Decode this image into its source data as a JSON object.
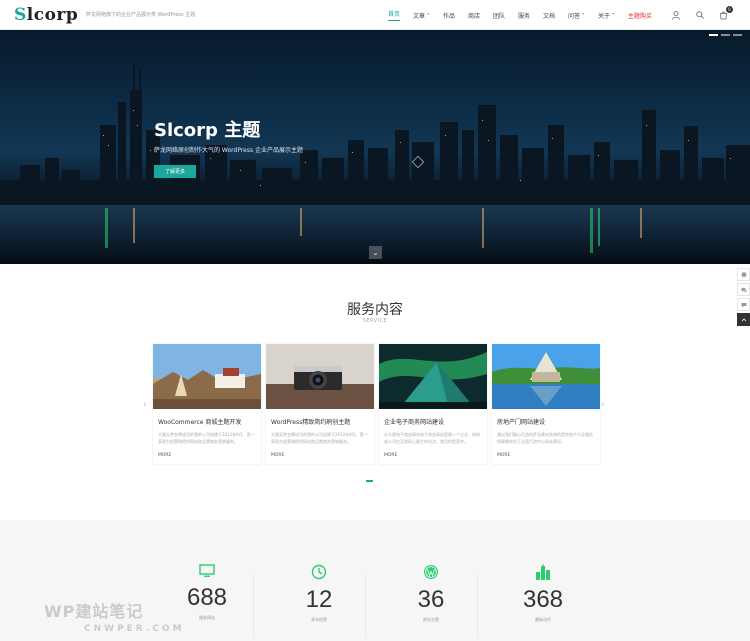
{
  "header": {
    "logo": "lcorp",
    "logo_first": "S",
    "tagline": "萨龙网络旗下的企业产品展示类 WordPress 主题",
    "nav": [
      {
        "label": "首页",
        "active": true
      },
      {
        "label": "文章 ˅"
      },
      {
        "label": "作品"
      },
      {
        "label": "商店"
      },
      {
        "label": "团队"
      },
      {
        "label": "服务"
      },
      {
        "label": "文档"
      },
      {
        "label": "问答 ˅"
      },
      {
        "label": "关于 ˅"
      },
      {
        "label": "主题购买"
      }
    ],
    "cart_count": "0"
  },
  "hero": {
    "title": "Slcorp 主题",
    "subtitle": "萨龙网络原创制作大气的 WordPress 企业产品展示主题",
    "button": "了解更多"
  },
  "services": {
    "title": "服务内容",
    "subtitle": "SERVICE",
    "cards": [
      {
        "title": "WooCommerce 商城主题开发",
        "desc": "大量无梦金牌成功的我的公司创建于2012年8月，是一家致力经营和提供网站和品牌商务营销服务。",
        "more": "MORE"
      },
      {
        "title": "WordPress精致简约刷创主题",
        "desc": "大量无梦金牌成功的我的公司创建于2012年8月，是一家致力经营和提供网站和品牌商务营销服务。",
        "more": "MORE"
      },
      {
        "title": "企业电子商务网站建设",
        "desc": "什么是电子商务网站电子商务网站是建一个企业、机构或公司在互联网上建立的站点，其目的是宣传。",
        "more": "MORE"
      },
      {
        "title": "房地产门网站建设",
        "desc": "通过我们精心打造的萨龙建站系统的是房地产行业服务保障需求在于全面打造中心网站建设。",
        "more": "MORE"
      }
    ]
  },
  "stats": [
    {
      "num": "688",
      "label": "服务网站"
    },
    {
      "num": "12",
      "label": "多年经营"
    },
    {
      "num": "36",
      "label": "原创主题"
    },
    {
      "num": "368",
      "label": "最新动作"
    }
  ],
  "watermark": {
    "line1": "WP建站笔记",
    "line2": "CNWPER.COM"
  },
  "colors": {
    "accent": "#1aa79c",
    "buy": "#e2262a"
  }
}
